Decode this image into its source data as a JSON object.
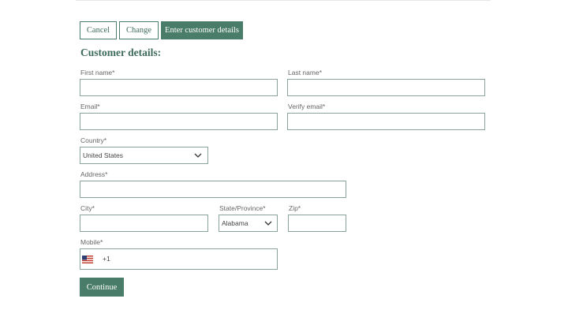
{
  "actions": {
    "cancel_label": "Cancel",
    "change_label": "Change",
    "enter_details_label": "Enter customer details"
  },
  "form": {
    "heading": "Customer details:",
    "first_name_label": "First name*",
    "last_name_label": "Last name*",
    "email_label": "Email*",
    "verify_email_label": "Verify email*",
    "country_label": "Country*",
    "country_value": "United States",
    "address_label": "Address*",
    "city_label": "City*",
    "state_label": "State/Province*",
    "state_value": "Alabama",
    "zip_label": "Zip*",
    "mobile_label": "Mobile*",
    "mobile_dial_code": "+1",
    "continue_label": "Continue"
  },
  "icons": {
    "chevron": "chevron-down-icon",
    "flag": "us-flag-icon"
  },
  "colors": {
    "accent": "#4a7c6a",
    "accent_text": "#3d6b5a",
    "field_border": "#8aa39a"
  }
}
